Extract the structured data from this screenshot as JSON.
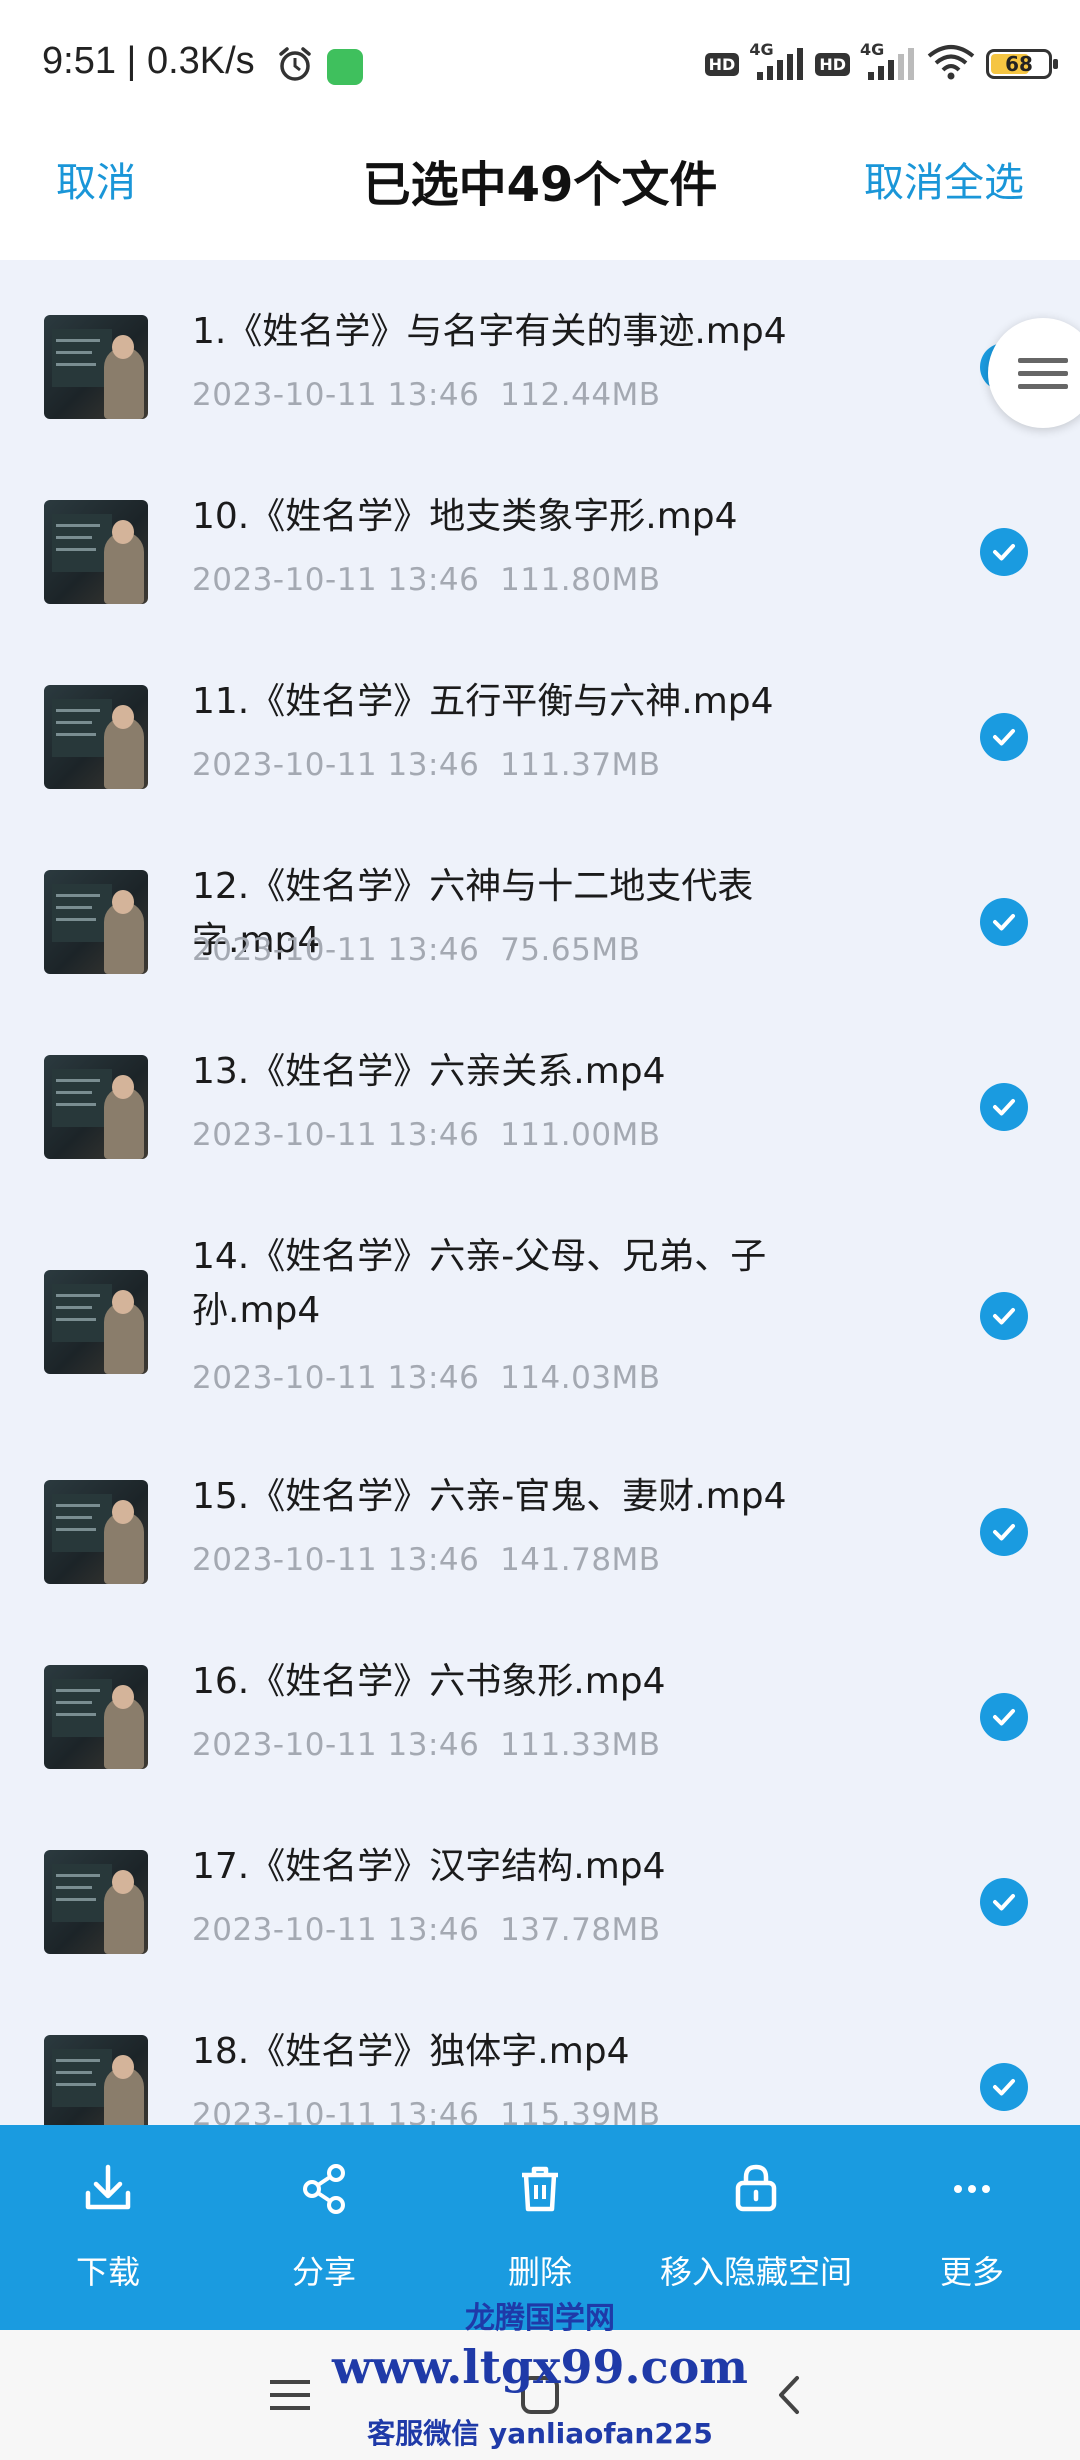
{
  "status_bar": {
    "time": "9:51 | 0.3K/s",
    "network_1": "4G",
    "network_2": "4G",
    "hd_1": "HD",
    "hd_2": "HD",
    "battery": "68",
    "battery_level": 0.68
  },
  "header": {
    "cancel": "取消",
    "title": "已选中49个文件",
    "cancel_all": "取消全选"
  },
  "files": [
    {
      "name": "1.《姓名学》与名字有关的事迹.mp4",
      "date": "2023-10-11  13:46",
      "size": "112.44MB",
      "selected": true
    },
    {
      "name": "10.《姓名学》地支类象字形.mp4",
      "date": "2023-10-11  13:46",
      "size": "111.80MB",
      "selected": true
    },
    {
      "name": "11.《姓名学》五行平衡与六神.mp4",
      "date": "2023-10-11  13:46",
      "size": "111.37MB",
      "selected": true
    },
    {
      "name": "12.《姓名学》六神与十二地支代表字.mp4",
      "date": "2023-10-11  13:46",
      "size": "75.65MB",
      "selected": true
    },
    {
      "name": "13.《姓名学》六亲关系.mp4",
      "date": "2023-10-11  13:46",
      "size": "111.00MB",
      "selected": true
    },
    {
      "name": "14.《姓名学》六亲-父母、兄弟、子孙.mp4",
      "date": "2023-10-11  13:46",
      "size": "114.03MB",
      "selected": true
    },
    {
      "name": "15.《姓名学》六亲-官鬼、妻财.mp4",
      "date": "2023-10-11  13:46",
      "size": "141.78MB",
      "selected": true
    },
    {
      "name": "16.《姓名学》六书象形.mp4",
      "date": "2023-10-11  13:46",
      "size": "111.33MB",
      "selected": true
    },
    {
      "name": "17.《姓名学》汉字结构.mp4",
      "date": "2023-10-11  13:46",
      "size": "137.78MB",
      "selected": true
    },
    {
      "name": "18.《姓名学》独体字.mp4",
      "date": "2023-10-11  13:46",
      "size": "115.39MB",
      "selected": true
    }
  ],
  "actions": [
    {
      "label": "下载",
      "icon": "download-icon"
    },
    {
      "label": "分享",
      "icon": "share-icon"
    },
    {
      "label": "删除",
      "icon": "trash-icon"
    },
    {
      "label": "移入隐藏空间",
      "icon": "lock-icon"
    },
    {
      "label": "更多",
      "icon": "more-icon"
    }
  ],
  "watermark": {
    "brand": "龙腾国学网",
    "url": "www.ltgx99.com",
    "contact": "客服微信 yanliaofan225"
  },
  "colors": {
    "accent": "#1a9be0",
    "background": "#eef2fa",
    "meta_text": "#a4a9b2",
    "watermark": "#1f3aa8"
  }
}
